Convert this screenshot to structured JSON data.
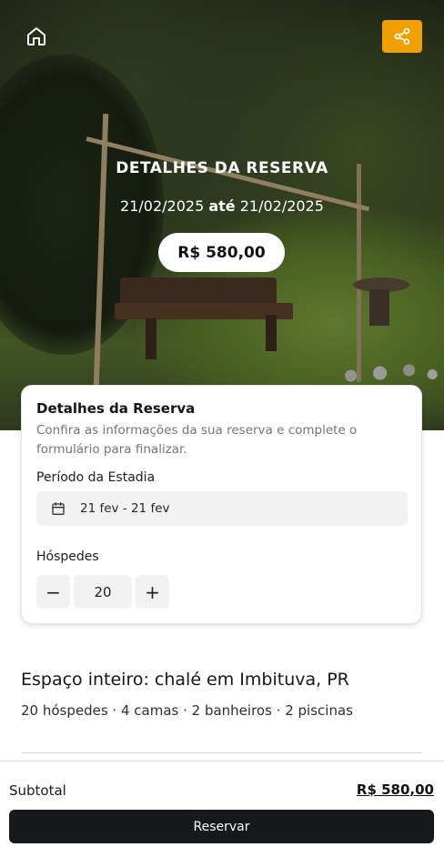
{
  "hero": {
    "title": "DETALHES DA RESERVA",
    "date_start": "21/02/2025",
    "date_connector": "até",
    "date_end": "21/02/2025",
    "price": "R$ 580,00"
  },
  "top_actions": {
    "home_icon": "home-icon",
    "share_icon": "share-icon",
    "share_color": "#f0a000"
  },
  "card": {
    "title": "Detalhes da Reserva",
    "description": "Confira as informações da sua reserva e complete o formulário para finalizar.",
    "period_label": "Período da Estadia",
    "period_value": "21 fev - 21 fev",
    "guests_label": "Hóspedes",
    "guests_value": "20",
    "minus": "−",
    "plus": "+"
  },
  "listing": {
    "title": "Espaço inteiro: chalé em Imbituva, PR",
    "summary": "20 hóspedes · 4 camas · 2 banheiros · 2 piscinas"
  },
  "footer": {
    "subtotal_label": "Subtotal",
    "subtotal_value": "R$ 580,00",
    "reserve_label": "Reservar"
  }
}
